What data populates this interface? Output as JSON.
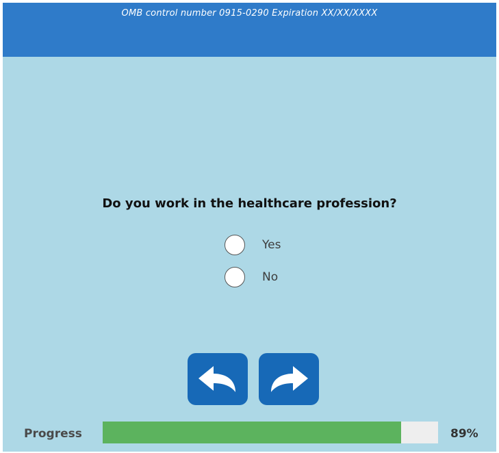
{
  "header": {
    "omb_text": "OMB control number 0915-0290 Expiration XX/XX/XXXX"
  },
  "question": {
    "text": "Do you work in the healthcare profession?",
    "options": [
      {
        "label": "Yes",
        "selected": false
      },
      {
        "label": "No",
        "selected": false
      }
    ]
  },
  "navigation": {
    "back_icon": "back-arrow-icon",
    "next_icon": "forward-arrow-icon"
  },
  "progress": {
    "label": "Progress",
    "percent_text": "89%",
    "percent": 89
  },
  "colors": {
    "header": "#2f7bc9",
    "background": "#add8e6",
    "button": "#1769b7",
    "progress_fill": "#5cb35e",
    "progress_track": "#eeeeee"
  }
}
